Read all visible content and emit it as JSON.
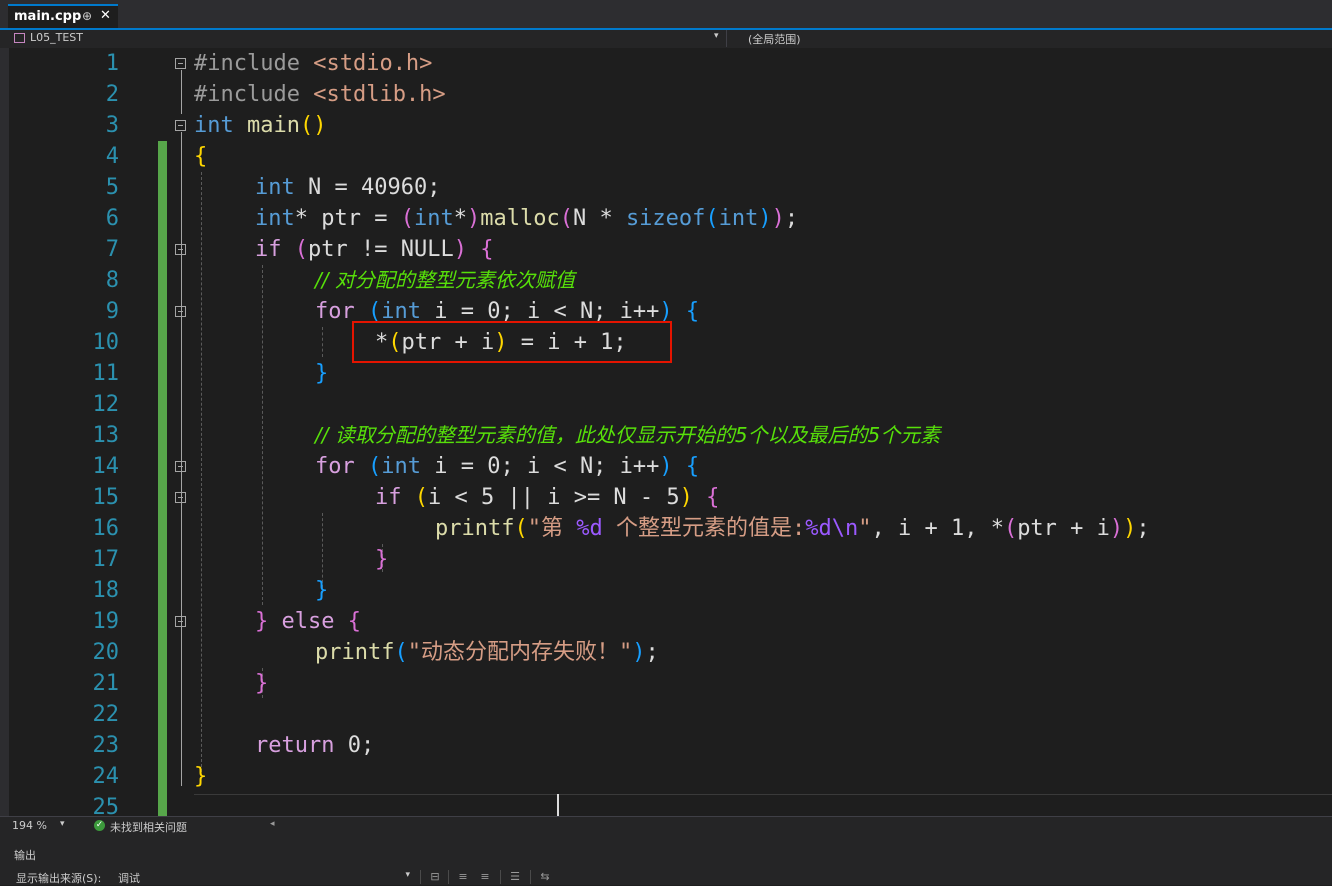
{
  "tab": {
    "title": "main.cpp",
    "pin": "⊕",
    "close": "✕"
  },
  "nav": {
    "project": "L05_TEST",
    "scope": "(全局范围)"
  },
  "editor": {
    "line_numbers": [
      "1",
      "2",
      "3",
      "4",
      "5",
      "6",
      "7",
      "8",
      "9",
      "10",
      "11",
      "12",
      "13",
      "14",
      "15",
      "16",
      "17",
      "18",
      "19",
      "20",
      "21",
      "22",
      "23",
      "24",
      "25"
    ],
    "lines": {
      "l1": [
        "#include ",
        "<stdio.h>"
      ],
      "l2": [
        "#include ",
        "<stdlib.h>"
      ],
      "l3": [
        "int",
        " ",
        "main",
        "()"
      ],
      "l4": [
        "{"
      ],
      "l5": [
        "int",
        " N = 40960;"
      ],
      "l6": [
        "int",
        "* ptr = ",
        "(",
        "int",
        "*",
        ")",
        "malloc",
        "(",
        "N * ",
        "sizeof",
        "(",
        "int",
        ")",
        ")",
        ";"
      ],
      "l7": [
        "if",
        " ",
        "(",
        "ptr != NULL",
        ")",
        " ",
        "{"
      ],
      "l8": [
        "// 对分配的整型元素依次赋值"
      ],
      "l9": [
        "for",
        " ",
        "(",
        "int",
        " i = 0; i < N; i++",
        ")",
        " ",
        "{"
      ],
      "l10": [
        "*",
        "(",
        "ptr + i",
        ")",
        " = i + 1;"
      ],
      "l11": [
        "}"
      ],
      "l13": [
        "// 读取分配的整型元素的值，此处仅显示开始的5个以及最后的5个元素"
      ],
      "l14": [
        "for",
        " ",
        "(",
        "int",
        " i = 0; i < N; i++",
        ")",
        " ",
        "{"
      ],
      "l15": [
        "if",
        " ",
        "(",
        "i < 5 || i >= N - 5",
        ")",
        " ",
        "{"
      ],
      "l16": [
        "printf",
        "(",
        "\"第 ",
        "%d",
        " 个整型元素的值是:",
        "%d",
        "\\n",
        "\"",
        ", i + 1, *",
        "(",
        "ptr + i",
        ")",
        ")",
        ";"
      ],
      "l17": [
        "}"
      ],
      "l18": [
        "}"
      ],
      "l19": [
        "}",
        " ",
        "else",
        " ",
        "{"
      ],
      "l20": [
        "printf",
        "(",
        "\"动态分配内存失败！\"",
        ")",
        ";"
      ],
      "l21": [
        "}"
      ],
      "l23": [
        "return",
        " 0;"
      ],
      "l24": [
        "}"
      ]
    }
  },
  "status": {
    "zoom": "194 %",
    "issues": "未找到相关问题"
  },
  "output": {
    "title": "输出",
    "source_label": "显示输出来源(S):",
    "source_value": "调试"
  },
  "colors": {
    "accent": "#007acc",
    "highlight_box": "#e51400",
    "change_bar": "#57a64a"
  }
}
